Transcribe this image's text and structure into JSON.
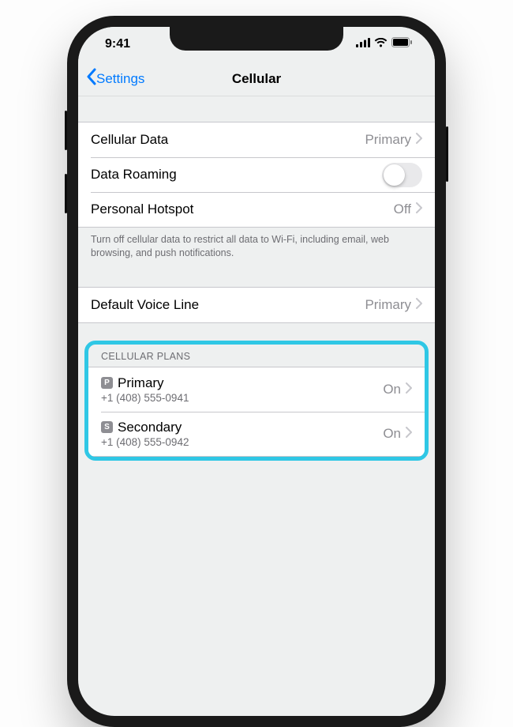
{
  "status": {
    "time": "9:41"
  },
  "nav": {
    "back": "Settings",
    "title": "Cellular"
  },
  "rows": {
    "cellular_data": {
      "label": "Cellular Data",
      "value": "Primary"
    },
    "data_roaming": {
      "label": "Data Roaming"
    },
    "personal_hotspot": {
      "label": "Personal Hotspot",
      "value": "Off"
    },
    "default_voice_line": {
      "label": "Default Voice Line",
      "value": "Primary"
    }
  },
  "footer_data_note": "Turn off cellular data to restrict all data to Wi-Fi, including email, web browsing, and push notifications.",
  "plans": {
    "header": "CELLULAR PLANS",
    "items": [
      {
        "badge": "P",
        "name": "Primary",
        "number": "+1 (408) 555-0941",
        "status": "On"
      },
      {
        "badge": "S",
        "name": "Secondary",
        "number": "+1 (408) 555-0942",
        "status": "On"
      }
    ]
  }
}
